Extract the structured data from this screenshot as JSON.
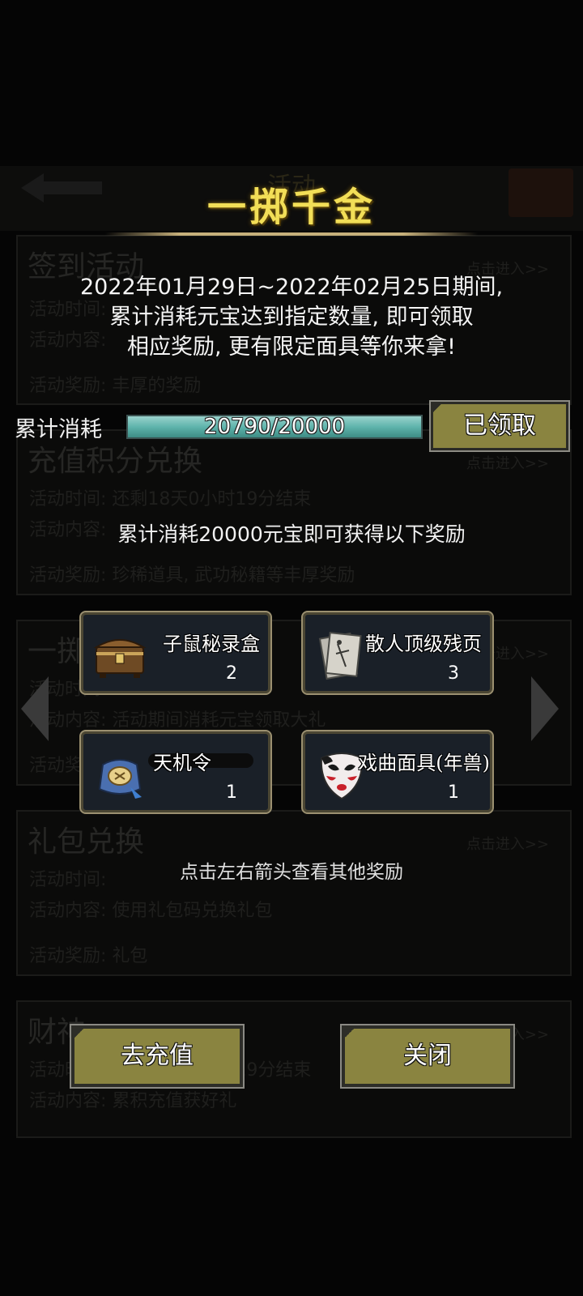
{
  "background": {
    "header_title": "活动",
    "cards": [
      {
        "title": "签到活动",
        "enter": "点击进入>>",
        "lines": [
          "活动时间:",
          "活动内容:",
          "活动奖励: 丰厚的奖励"
        ]
      },
      {
        "title": "充值积分兑换",
        "enter": "点击进入>>",
        "lines": [
          "活动时间: 还剩18天0小时19分结束",
          "活动内容:",
          "活动奖励: 珍稀道具, 武功秘籍等丰厚奖励"
        ]
      },
      {
        "title": "一掷",
        "enter": "点击进入>>",
        "lines": [
          "活动时间:",
          "活动内容: 活动期间消耗元宝领取大礼",
          "活动奖励:"
        ]
      },
      {
        "title": "礼包兑换",
        "enter": "点击进入>>",
        "lines": [
          "活动时间:",
          "活动内容: 使用礼包码兑换礼包",
          "活动奖励: 礼包"
        ]
      },
      {
        "title": "财神",
        "enter": "点击进入>>",
        "lines": [
          "活动时间: 还剩18天0小时19分结束",
          "活动内容: 累积充值获好礼"
        ]
      }
    ]
  },
  "panel": {
    "title": "一掷千金",
    "description": [
      "2022年01月29日~2022年02月25日期间,",
      "累计消耗元宝达到指定数量, 即可领取",
      "相应奖励, 更有限定面具等你来拿!"
    ],
    "progress": {
      "label": "累计消耗",
      "text": "20790/20000",
      "current": 20790,
      "target": 20000,
      "fill_fraction": 1.0
    },
    "claim_button": "已领取",
    "reward_note": "累计消耗20000元宝即可获得以下奖励",
    "rewards": [
      {
        "name": "子鼠秘录盒",
        "count": "2",
        "icon": "treasure-chest-icon"
      },
      {
        "name": "散人顶级残页",
        "count": "3",
        "icon": "scroll-pages-icon"
      },
      {
        "name": "天机令",
        "count": "1",
        "icon": "token-pouch-icon"
      },
      {
        "name": "戏曲面具(年兽)",
        "count": "1",
        "icon": "opera-mask-icon"
      }
    ],
    "hint": "点击左右箭头查看其他奖励",
    "recharge_button": "去充值",
    "close_button": "关闭"
  },
  "colors": {
    "title_gold": "#f2de57",
    "button_olive": "#8a8440",
    "progress_teal": "#5fb4ac"
  }
}
